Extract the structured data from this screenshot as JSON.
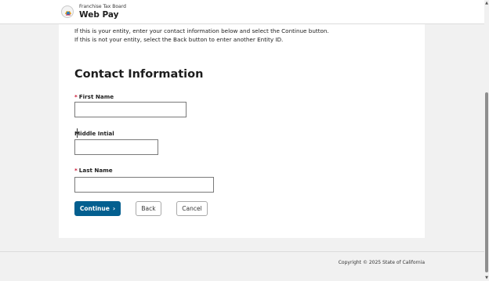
{
  "header": {
    "agency": "Franchise Tax Board",
    "app_name": "Web Pay",
    "logo_icon": "ca-state-seal-icon"
  },
  "instructions": {
    "line1": "If this is your entity, enter your contact information below and select the Continue button.",
    "line2": "If this is not your entity, select the Back button to enter another Entity ID."
  },
  "form": {
    "title": "Contact Information",
    "required_marker": "*",
    "first_name": {
      "label": "First Name",
      "value": "",
      "required": true
    },
    "middle_initial": {
      "label": "Middle Intial",
      "value": "",
      "required": false
    },
    "last_name": {
      "label": "Last Name",
      "value": "",
      "required": true
    }
  },
  "buttons": {
    "continue": "Continue",
    "continue_icon": "chevron-right-icon",
    "back": "Back",
    "cancel": "Cancel"
  },
  "footer": {
    "copyright": "Copyright © 2025 State of California"
  },
  "colors": {
    "primary": "#035f8f",
    "required": "#c8102e",
    "page_bg": "#f1f1f1"
  }
}
